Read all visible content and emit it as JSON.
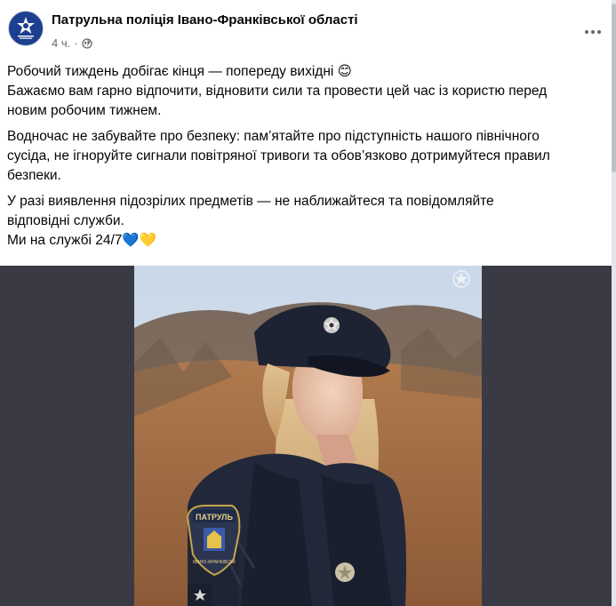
{
  "post": {
    "author": "Патрульна поліція Івано-Франківської області",
    "time": "4 ч.",
    "separator": "·",
    "privacy_icon": "globe-icon",
    "more_icon": "more-dots-icon",
    "paragraphs": [
      [
        "Робочий тиждень добігає кінця — попереду вихідні 😊",
        "Бажаємо вам гарно відпочити, відновити сили та провести цей час із користю перед",
        "новим робочим тижнем."
      ],
      [
        "Водночас не забувайте про безпеку: пам’ятайте про підступність нашого північного",
        "сусіда, не ігноруйте сигнали повітряної тривоги та обов’язково дотримуйтеся правил",
        "безпеки."
      ],
      [
        "У разі виявлення підозрілих предметів — не наближайтеся та повідомляйте",
        "відповідні служби.",
        "Ми на службі 24/7💙💛"
      ]
    ]
  },
  "photo": {
    "patch_top": "ПАТРУЛЬ",
    "patch_bottom": "ІВАНО-ФРАНКІВСЬК"
  },
  "colors": {
    "avatar_bg": "#1c3f8f",
    "photo_bg": "#3a3a45",
    "text": "#050505",
    "muted": "#65676b"
  }
}
